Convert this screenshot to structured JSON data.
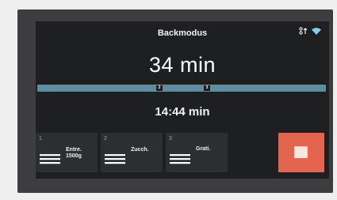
{
  "header": {
    "mode_title": "Backmodus",
    "icons": [
      "temperature-icon",
      "wifi-icon"
    ]
  },
  "timer": {
    "remaining": "34 min",
    "end_time": "14:44 min"
  },
  "progress": {
    "markers": [
      "2",
      "3"
    ]
  },
  "steps": [
    {
      "number": "1",
      "label": "Entre.\n1500g",
      "icon": "layers-icon"
    },
    {
      "number": "2",
      "label": "Zucch.",
      "icon": "layers-icon"
    },
    {
      "number": "3",
      "label": "Grati.",
      "icon": "layers-icon"
    }
  ],
  "stop_button": {
    "icon": "stop-icon"
  },
  "colors": {
    "screen_bg": "#1d1f21",
    "progress": "#5b8ea3",
    "tile": "#2c2f32",
    "stop": "#e3654e"
  }
}
